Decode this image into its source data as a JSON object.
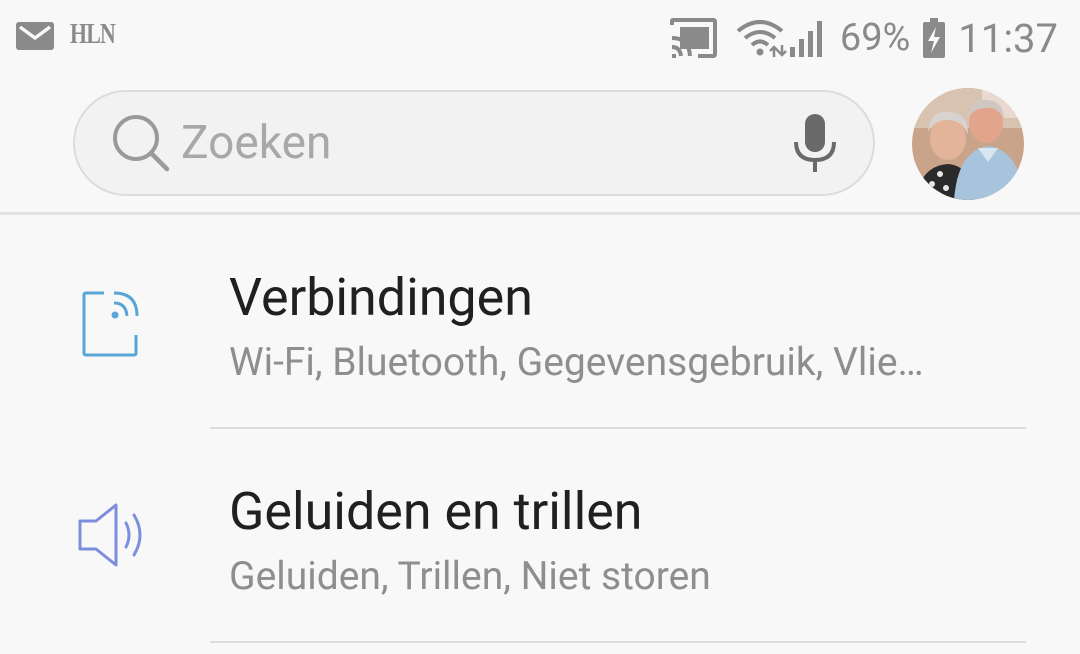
{
  "status_bar": {
    "notifications": [
      {
        "icon": "mail-icon"
      },
      {
        "app_label": "HLN"
      }
    ],
    "indicators": [
      "cast-icon",
      "wifi-icon",
      "signal-icon"
    ],
    "battery_percent": "69%",
    "battery_icon": "battery-charging-icon",
    "time": "11:37"
  },
  "search": {
    "placeholder": "Zoeken",
    "icon": "search-icon",
    "voice_icon": "microphone-icon"
  },
  "profile": {
    "icon": "avatar"
  },
  "settings_items": [
    {
      "title": "Verbindingen",
      "subtitle": "Wi-Fi, Bluetooth, Gegevensgebruik, Vlie…",
      "icon": "connections-icon",
      "icon_color": "#5aa5d8"
    },
    {
      "title": "Geluiden en trillen",
      "subtitle": "Geluiden, Trillen, Niet storen",
      "icon": "speaker-icon",
      "icon_color": "#7d8ede"
    }
  ]
}
